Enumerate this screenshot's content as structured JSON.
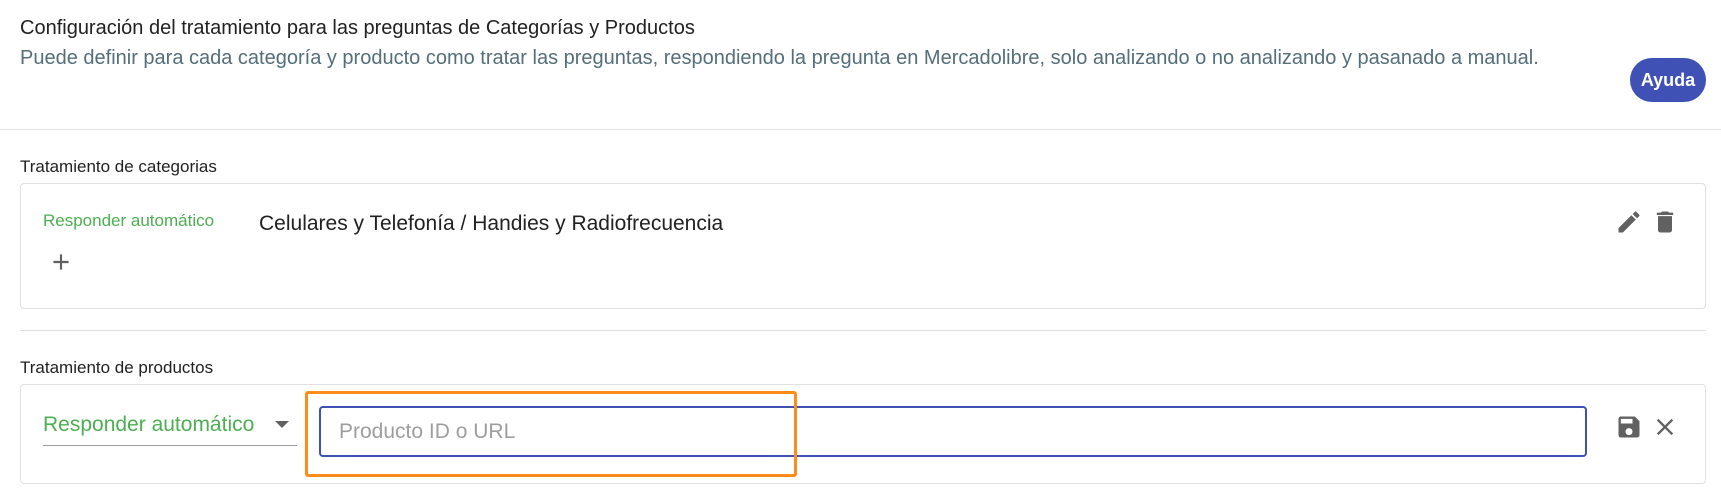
{
  "header": {
    "title": "Configuración del tratamiento para las preguntas de Categorías y Productos",
    "description": "Puede definir para cada categoría y producto como tratar las preguntas, respondiendo la pregunta en Mercadolibre, solo analizando o no analizando y pasanado a manual.",
    "help_label": "Ayuda"
  },
  "categories": {
    "section_title": "Tratamiento de categorias",
    "rows": [
      {
        "mode": "Responder automático",
        "category": "Celulares y Telefonía / Handies y Radiofrecuencia"
      }
    ]
  },
  "products": {
    "section_title": "Tratamiento de productos",
    "mode_selected": "Responder automático",
    "input_placeholder": "Producto ID o URL",
    "input_value": ""
  },
  "colors": {
    "accent": "#3f51b5",
    "green": "#4caf50",
    "highlight": "#ff8c1a"
  },
  "icons": [
    "pencil-icon",
    "trash-icon",
    "plus-icon",
    "caret-down-icon",
    "save-icon",
    "close-icon"
  ]
}
